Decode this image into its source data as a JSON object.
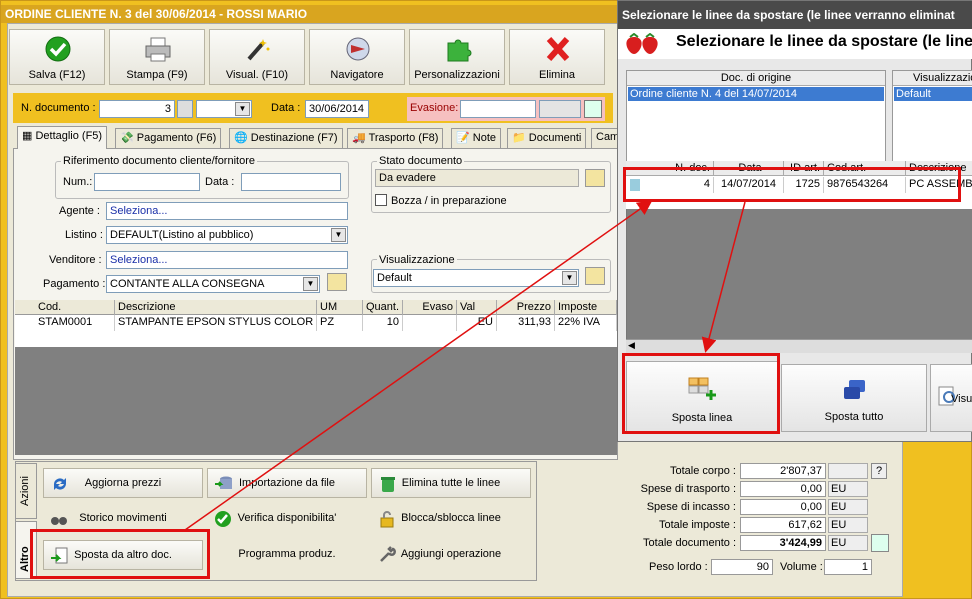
{
  "window": {
    "title": "ORDINE CLIENTE N. 3 del 30/06/2014 - ROSSI MARIO"
  },
  "toolbar": {
    "save": "Salva (F12)",
    "print": "Stampa (F9)",
    "visual": "Visual. (F10)",
    "navigator": "Navigatore",
    "custom": "Personalizzazioni",
    "delete": "Elimina"
  },
  "header": {
    "doc_label": "N. documento :",
    "doc_value": "3",
    "date_label": "Data :",
    "date_value": "30/06/2014",
    "evasione_label": "Evasione:"
  },
  "tabs": [
    "Dettaglio (F5)",
    "Pagamento (F6)",
    "Destinazione (F7)",
    "Trasporto (F8)",
    "Note",
    "Documenti",
    "Cam"
  ],
  "rif": {
    "title": "Riferimento documento cliente/fornitore",
    "num": "Num.:",
    "data": "Data :"
  },
  "stato": {
    "title": "Stato documento",
    "value": "Da evadere",
    "bozza": "Bozza / in preparazione"
  },
  "fields": {
    "agente_l": "Agente :",
    "agente": "Seleziona...",
    "listino_l": "Listino :",
    "listino": "DEFAULT(Listino al pubblico)",
    "venditore_l": "Venditore :",
    "venditore": "Seleziona...",
    "pagamento_l": "Pagamento :",
    "pagamento": "CONTANTE ALLA CONSEGNA"
  },
  "visual": {
    "title": "Visualizzazione",
    "value": "Default"
  },
  "grid": {
    "headers": [
      "Cod.",
      "Descrizione",
      "UM",
      "Quant.",
      "Evaso",
      "Val",
      "Prezzo",
      "Imposte"
    ],
    "rows": [
      [
        "STAM0001",
        "STAMPANTE EPSON STYLUS COLOR C...",
        "PZ",
        "10",
        "",
        "EU",
        "311,93",
        "22% IVA"
      ]
    ]
  },
  "side_tabs": {
    "azioni": "Azioni",
    "altro": "Altro"
  },
  "actions": {
    "aggiorna": "Aggiorna prezzi",
    "importazione": "Importazione da file",
    "elimina": "Elimina tutte le linee",
    "storico": "Storico movimenti",
    "verifica": "Verifica disponibilita'",
    "blocca": "Blocca/sblocca linee",
    "sposta": "Sposta da altro doc.",
    "programma": "Programma produz.",
    "aggiungi": "Aggiungi operazione"
  },
  "totals": {
    "corpo_l": "Totale corpo :",
    "corpo": "2'807,37",
    "trasporto_l": "Spese di trasporto :",
    "trasporto": "0,00",
    "incasso_l": "Spese di incasso :",
    "incasso": "0,00",
    "imposte_l": "Totale imposte :",
    "imposte": "617,62",
    "documento_l": "Totale documento :",
    "documento": "3'424,99",
    "eu": "EU",
    "q": "?",
    "peso_l": "Peso lordo :",
    "peso": "90",
    "volume_l": "Volume :",
    "volume": "1"
  },
  "dialog": {
    "title": "Selezionare le linee da spostare (le linee verranno eliminat",
    "heading": "Selezionare le linee da spostare (le linee",
    "origin_h": "Doc. di origine",
    "origin_item": "Ordine cliente N. 4 del 14/07/2014",
    "vis_h": "Visualizzazione",
    "vis_item": "Default",
    "lines_h": [
      "N. doc.",
      "Data",
      "ID art.",
      "Cod.art.",
      "Descrizione"
    ],
    "line": [
      "4",
      "14/07/2014",
      "1725",
      "9876543264",
      "PC ASSEMBLA"
    ],
    "sposta_linea": "Sposta linea",
    "sposta_tutto": "Sposta tutto",
    "visual": "Visua"
  }
}
